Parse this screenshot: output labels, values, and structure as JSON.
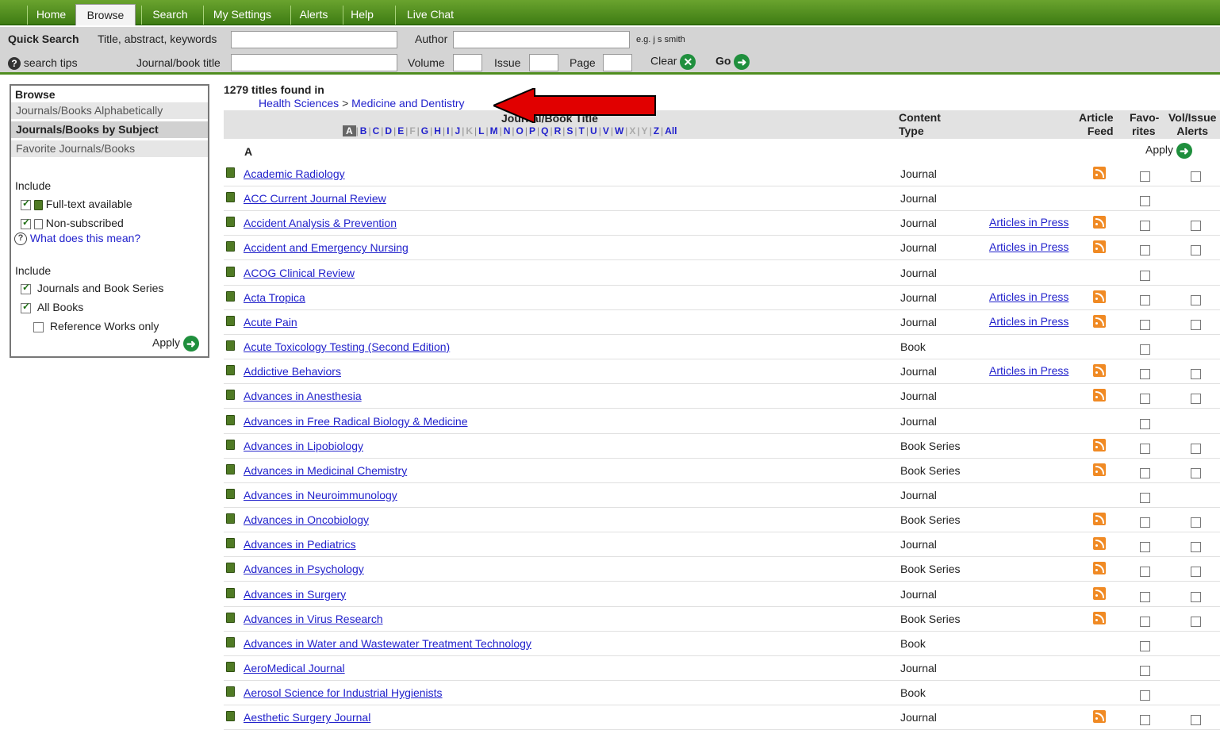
{
  "nav": {
    "tabs": [
      {
        "label": "Home",
        "active": false
      },
      {
        "label": "Browse",
        "active": true
      },
      {
        "label": "Search",
        "active": false
      },
      {
        "label": "My Settings",
        "active": false
      },
      {
        "label": "Alerts",
        "active": false
      },
      {
        "label": "Help",
        "active": false
      },
      {
        "label": "Live Chat",
        "active": false
      }
    ]
  },
  "quick_search": {
    "label": "Quick Search",
    "title_label": "Title, abstract, keywords",
    "title_value": "",
    "author_label": "Author",
    "author_value": "",
    "author_example": "e.g. j s smith",
    "search_tips": "search tips",
    "journal_label": "Journal/book title",
    "journal_value": "",
    "volume_label": "Volume",
    "volume_value": "",
    "issue_label": "Issue",
    "issue_value": "",
    "page_label": "Page",
    "page_value": "",
    "clear_label": "Clear",
    "go_label": "Go"
  },
  "sidebar": {
    "header": "Browse",
    "items": [
      {
        "label": "Journals/Books Alphabetically",
        "selected": false
      },
      {
        "label": "Journals/Books by Subject",
        "selected": true
      },
      {
        "label": "Favorite Journals/Books",
        "selected": false
      }
    ],
    "include1_label": "Include",
    "fulltext_label": "Full-text available",
    "nonsub_label": "Non-subscribed",
    "what_label": "What does this mean?",
    "include2_label": "Include",
    "journals_series_label": "Journals and Book Series",
    "all_books_label": "All Books",
    "reference_label": "Reference Works only",
    "apply_label": "Apply"
  },
  "main": {
    "found": "1279 titles found in",
    "crumb_parent": "Health Sciences",
    "crumb_sep": ">",
    "crumb_child": "Medicine and Dentistry",
    "col_title": "Journal/Book Title",
    "col_content1": "Content",
    "col_content2": "Type",
    "col_feed1": "Article",
    "col_feed2": "Feed",
    "col_fav1": "Favo-",
    "col_fav2": "rites",
    "col_alerts1": "Vol/Issue",
    "col_alerts2": "Alerts",
    "letters": [
      "A",
      "B",
      "C",
      "D",
      "E",
      "F",
      "G",
      "H",
      "I",
      "J",
      "K",
      "L",
      "M",
      "N",
      "O",
      "P",
      "Q",
      "R",
      "S",
      "T",
      "U",
      "V",
      "W",
      "X",
      "Y",
      "Z",
      "All"
    ],
    "active_letter": "A",
    "disabled_letters": [
      "F",
      "K",
      "X",
      "Y"
    ],
    "section": "A",
    "apply_label": "Apply",
    "rows": [
      {
        "title": "Academic Radiology",
        "type": "Journal",
        "aip": "",
        "rss": true,
        "alert": true
      },
      {
        "title": "ACC Current Journal Review",
        "type": "Journal",
        "aip": "",
        "rss": false,
        "alert": false
      },
      {
        "title": "Accident Analysis & Prevention",
        "type": "Journal",
        "aip": "Articles in Press",
        "rss": true,
        "alert": true
      },
      {
        "title": "Accident and Emergency Nursing",
        "type": "Journal",
        "aip": "Articles in Press",
        "rss": true,
        "alert": true
      },
      {
        "title": "ACOG Clinical Review",
        "type": "Journal",
        "aip": "",
        "rss": false,
        "alert": false
      },
      {
        "title": "Acta Tropica",
        "type": "Journal",
        "aip": "Articles in Press",
        "rss": true,
        "alert": true
      },
      {
        "title": "Acute Pain",
        "type": "Journal",
        "aip": "Articles in Press",
        "rss": true,
        "alert": true
      },
      {
        "title": "Acute Toxicology Testing (Second Edition)",
        "type": "Book",
        "aip": "",
        "rss": false,
        "alert": false
      },
      {
        "title": "Addictive Behaviors",
        "type": "Journal",
        "aip": "Articles in Press",
        "rss": true,
        "alert": true
      },
      {
        "title": "Advances in Anesthesia",
        "type": "Journal",
        "aip": "",
        "rss": true,
        "alert": true
      },
      {
        "title": "Advances in Free Radical Biology & Medicine",
        "type": "Journal",
        "aip": "",
        "rss": false,
        "alert": false
      },
      {
        "title": "Advances in Lipobiology",
        "type": "Book Series",
        "aip": "",
        "rss": true,
        "alert": true
      },
      {
        "title": "Advances in Medicinal Chemistry",
        "type": "Book Series",
        "aip": "",
        "rss": true,
        "alert": true
      },
      {
        "title": "Advances in Neuroimmunology",
        "type": "Journal",
        "aip": "",
        "rss": false,
        "alert": false
      },
      {
        "title": "Advances in Oncobiology",
        "type": "Book Series",
        "aip": "",
        "rss": true,
        "alert": true
      },
      {
        "title": "Advances in Pediatrics",
        "type": "Journal",
        "aip": "",
        "rss": true,
        "alert": true
      },
      {
        "title": "Advances in Psychology",
        "type": "Book Series",
        "aip": "",
        "rss": true,
        "alert": true
      },
      {
        "title": "Advances in Surgery",
        "type": "Journal",
        "aip": "",
        "rss": true,
        "alert": true
      },
      {
        "title": "Advances in Virus Research",
        "type": "Book Series",
        "aip": "",
        "rss": true,
        "alert": true
      },
      {
        "title": "Advances in Water and Wastewater Treatment Technology",
        "type": "Book",
        "aip": "",
        "rss": false,
        "alert": false
      },
      {
        "title": "AeroMedical Journal",
        "type": "Journal",
        "aip": "",
        "rss": false,
        "alert": false
      },
      {
        "title": "Aerosol Science for Industrial Hygienists",
        "type": "Book",
        "aip": "",
        "rss": false,
        "alert": false
      },
      {
        "title": "Aesthetic Surgery Journal",
        "type": "Journal",
        "aip": "",
        "rss": true,
        "alert": true
      }
    ]
  }
}
